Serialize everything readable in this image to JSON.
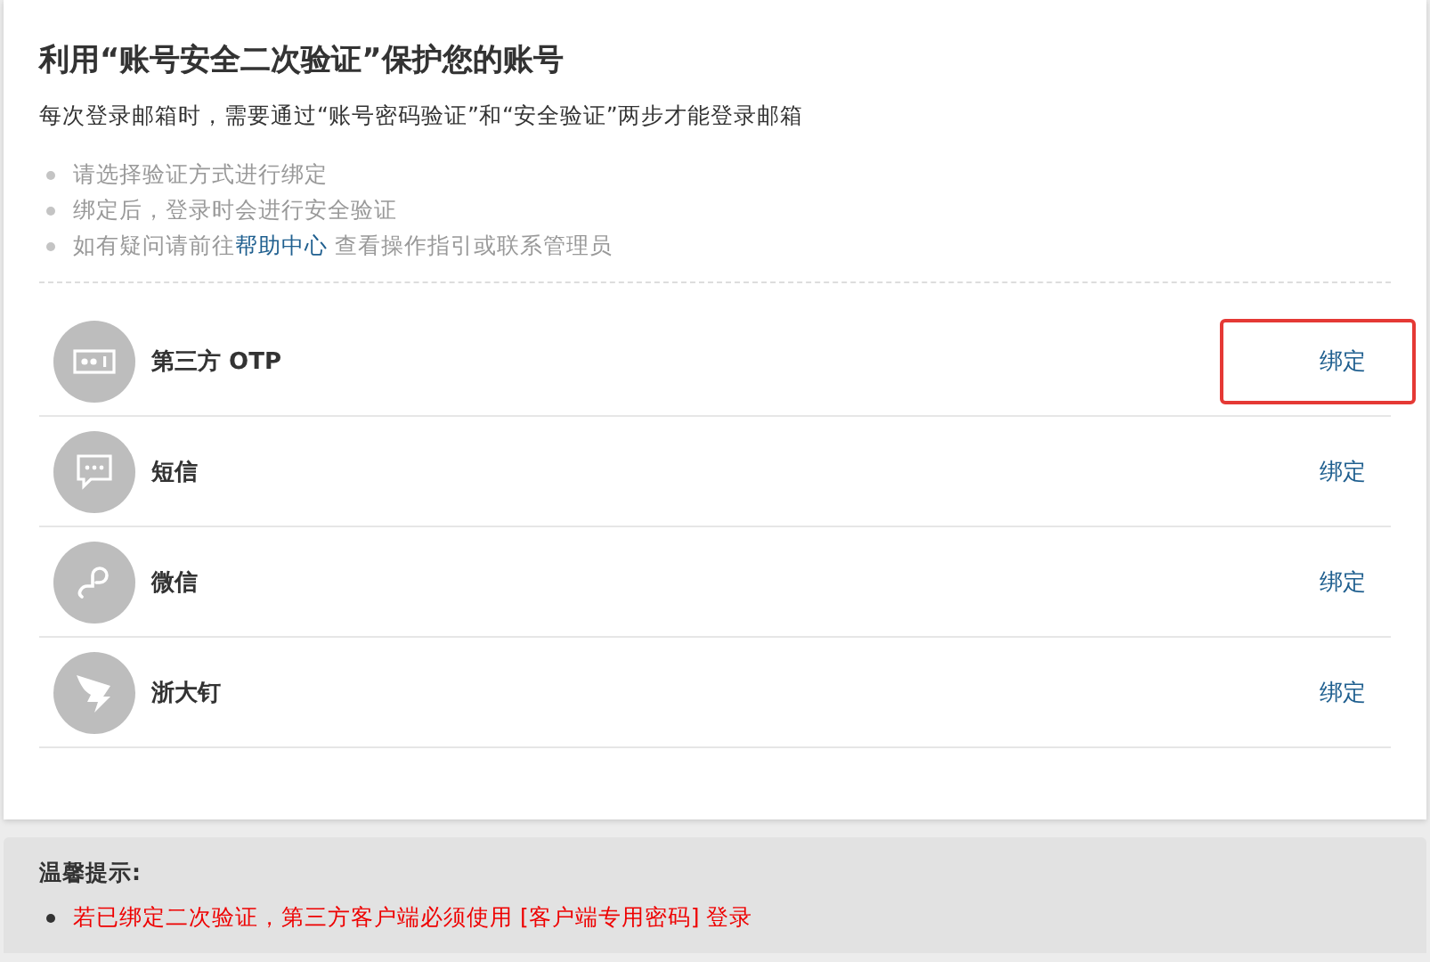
{
  "title": "利用“账号安全二次验证”保护您的账号",
  "subtitle": "每次登录邮箱时，需要通过“账号密码验证”和“安全验证”两步才能登录邮箱",
  "notes": [
    {
      "text": "请选择验证方式进行绑定"
    },
    {
      "text": "绑定后，登录时会进行安全验证"
    },
    {
      "text": "如有疑问请前往",
      "link": "帮助中心",
      "after": "查看操作指引或联系管理员"
    }
  ],
  "methods": [
    {
      "kind": "otp",
      "name": "第三方 OTP",
      "action": "绑定",
      "highlighted": true
    },
    {
      "kind": "sms",
      "name": "短信",
      "action": "绑定",
      "highlighted": false
    },
    {
      "kind": "wechat",
      "name": "微信",
      "action": "绑定",
      "highlighted": false
    },
    {
      "kind": "dingtalk",
      "name": "浙大钉",
      "action": "绑定",
      "highlighted": false
    }
  ],
  "tips": {
    "title": "温馨提示:",
    "items": [
      "若已绑定二次验证，第三方客户端必须使用 [客户端专用密码] 登录"
    ]
  }
}
